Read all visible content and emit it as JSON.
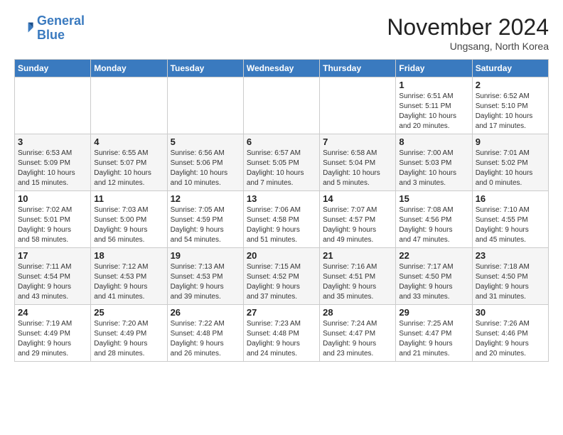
{
  "logo": {
    "line1": "General",
    "line2": "Blue"
  },
  "header": {
    "month": "November 2024",
    "location": "Ungsang, North Korea"
  },
  "days_of_week": [
    "Sunday",
    "Monday",
    "Tuesday",
    "Wednesday",
    "Thursday",
    "Friday",
    "Saturday"
  ],
  "weeks": [
    [
      {
        "day": "",
        "info": ""
      },
      {
        "day": "",
        "info": ""
      },
      {
        "day": "",
        "info": ""
      },
      {
        "day": "",
        "info": ""
      },
      {
        "day": "",
        "info": ""
      },
      {
        "day": "1",
        "info": "Sunrise: 6:51 AM\nSunset: 5:11 PM\nDaylight: 10 hours\nand 20 minutes."
      },
      {
        "day": "2",
        "info": "Sunrise: 6:52 AM\nSunset: 5:10 PM\nDaylight: 10 hours\nand 17 minutes."
      }
    ],
    [
      {
        "day": "3",
        "info": "Sunrise: 6:53 AM\nSunset: 5:09 PM\nDaylight: 10 hours\nand 15 minutes."
      },
      {
        "day": "4",
        "info": "Sunrise: 6:55 AM\nSunset: 5:07 PM\nDaylight: 10 hours\nand 12 minutes."
      },
      {
        "day": "5",
        "info": "Sunrise: 6:56 AM\nSunset: 5:06 PM\nDaylight: 10 hours\nand 10 minutes."
      },
      {
        "day": "6",
        "info": "Sunrise: 6:57 AM\nSunset: 5:05 PM\nDaylight: 10 hours\nand 7 minutes."
      },
      {
        "day": "7",
        "info": "Sunrise: 6:58 AM\nSunset: 5:04 PM\nDaylight: 10 hours\nand 5 minutes."
      },
      {
        "day": "8",
        "info": "Sunrise: 7:00 AM\nSunset: 5:03 PM\nDaylight: 10 hours\nand 3 minutes."
      },
      {
        "day": "9",
        "info": "Sunrise: 7:01 AM\nSunset: 5:02 PM\nDaylight: 10 hours\nand 0 minutes."
      }
    ],
    [
      {
        "day": "10",
        "info": "Sunrise: 7:02 AM\nSunset: 5:01 PM\nDaylight: 9 hours\nand 58 minutes."
      },
      {
        "day": "11",
        "info": "Sunrise: 7:03 AM\nSunset: 5:00 PM\nDaylight: 9 hours\nand 56 minutes."
      },
      {
        "day": "12",
        "info": "Sunrise: 7:05 AM\nSunset: 4:59 PM\nDaylight: 9 hours\nand 54 minutes."
      },
      {
        "day": "13",
        "info": "Sunrise: 7:06 AM\nSunset: 4:58 PM\nDaylight: 9 hours\nand 51 minutes."
      },
      {
        "day": "14",
        "info": "Sunrise: 7:07 AM\nSunset: 4:57 PM\nDaylight: 9 hours\nand 49 minutes."
      },
      {
        "day": "15",
        "info": "Sunrise: 7:08 AM\nSunset: 4:56 PM\nDaylight: 9 hours\nand 47 minutes."
      },
      {
        "day": "16",
        "info": "Sunrise: 7:10 AM\nSunset: 4:55 PM\nDaylight: 9 hours\nand 45 minutes."
      }
    ],
    [
      {
        "day": "17",
        "info": "Sunrise: 7:11 AM\nSunset: 4:54 PM\nDaylight: 9 hours\nand 43 minutes."
      },
      {
        "day": "18",
        "info": "Sunrise: 7:12 AM\nSunset: 4:53 PM\nDaylight: 9 hours\nand 41 minutes."
      },
      {
        "day": "19",
        "info": "Sunrise: 7:13 AM\nSunset: 4:53 PM\nDaylight: 9 hours\nand 39 minutes."
      },
      {
        "day": "20",
        "info": "Sunrise: 7:15 AM\nSunset: 4:52 PM\nDaylight: 9 hours\nand 37 minutes."
      },
      {
        "day": "21",
        "info": "Sunrise: 7:16 AM\nSunset: 4:51 PM\nDaylight: 9 hours\nand 35 minutes."
      },
      {
        "day": "22",
        "info": "Sunrise: 7:17 AM\nSunset: 4:50 PM\nDaylight: 9 hours\nand 33 minutes."
      },
      {
        "day": "23",
        "info": "Sunrise: 7:18 AM\nSunset: 4:50 PM\nDaylight: 9 hours\nand 31 minutes."
      }
    ],
    [
      {
        "day": "24",
        "info": "Sunrise: 7:19 AM\nSunset: 4:49 PM\nDaylight: 9 hours\nand 29 minutes."
      },
      {
        "day": "25",
        "info": "Sunrise: 7:20 AM\nSunset: 4:49 PM\nDaylight: 9 hours\nand 28 minutes."
      },
      {
        "day": "26",
        "info": "Sunrise: 7:22 AM\nSunset: 4:48 PM\nDaylight: 9 hours\nand 26 minutes."
      },
      {
        "day": "27",
        "info": "Sunrise: 7:23 AM\nSunset: 4:48 PM\nDaylight: 9 hours\nand 24 minutes."
      },
      {
        "day": "28",
        "info": "Sunrise: 7:24 AM\nSunset: 4:47 PM\nDaylight: 9 hours\nand 23 minutes."
      },
      {
        "day": "29",
        "info": "Sunrise: 7:25 AM\nSunset: 4:47 PM\nDaylight: 9 hours\nand 21 minutes."
      },
      {
        "day": "30",
        "info": "Sunrise: 7:26 AM\nSunset: 4:46 PM\nDaylight: 9 hours\nand 20 minutes."
      }
    ]
  ]
}
